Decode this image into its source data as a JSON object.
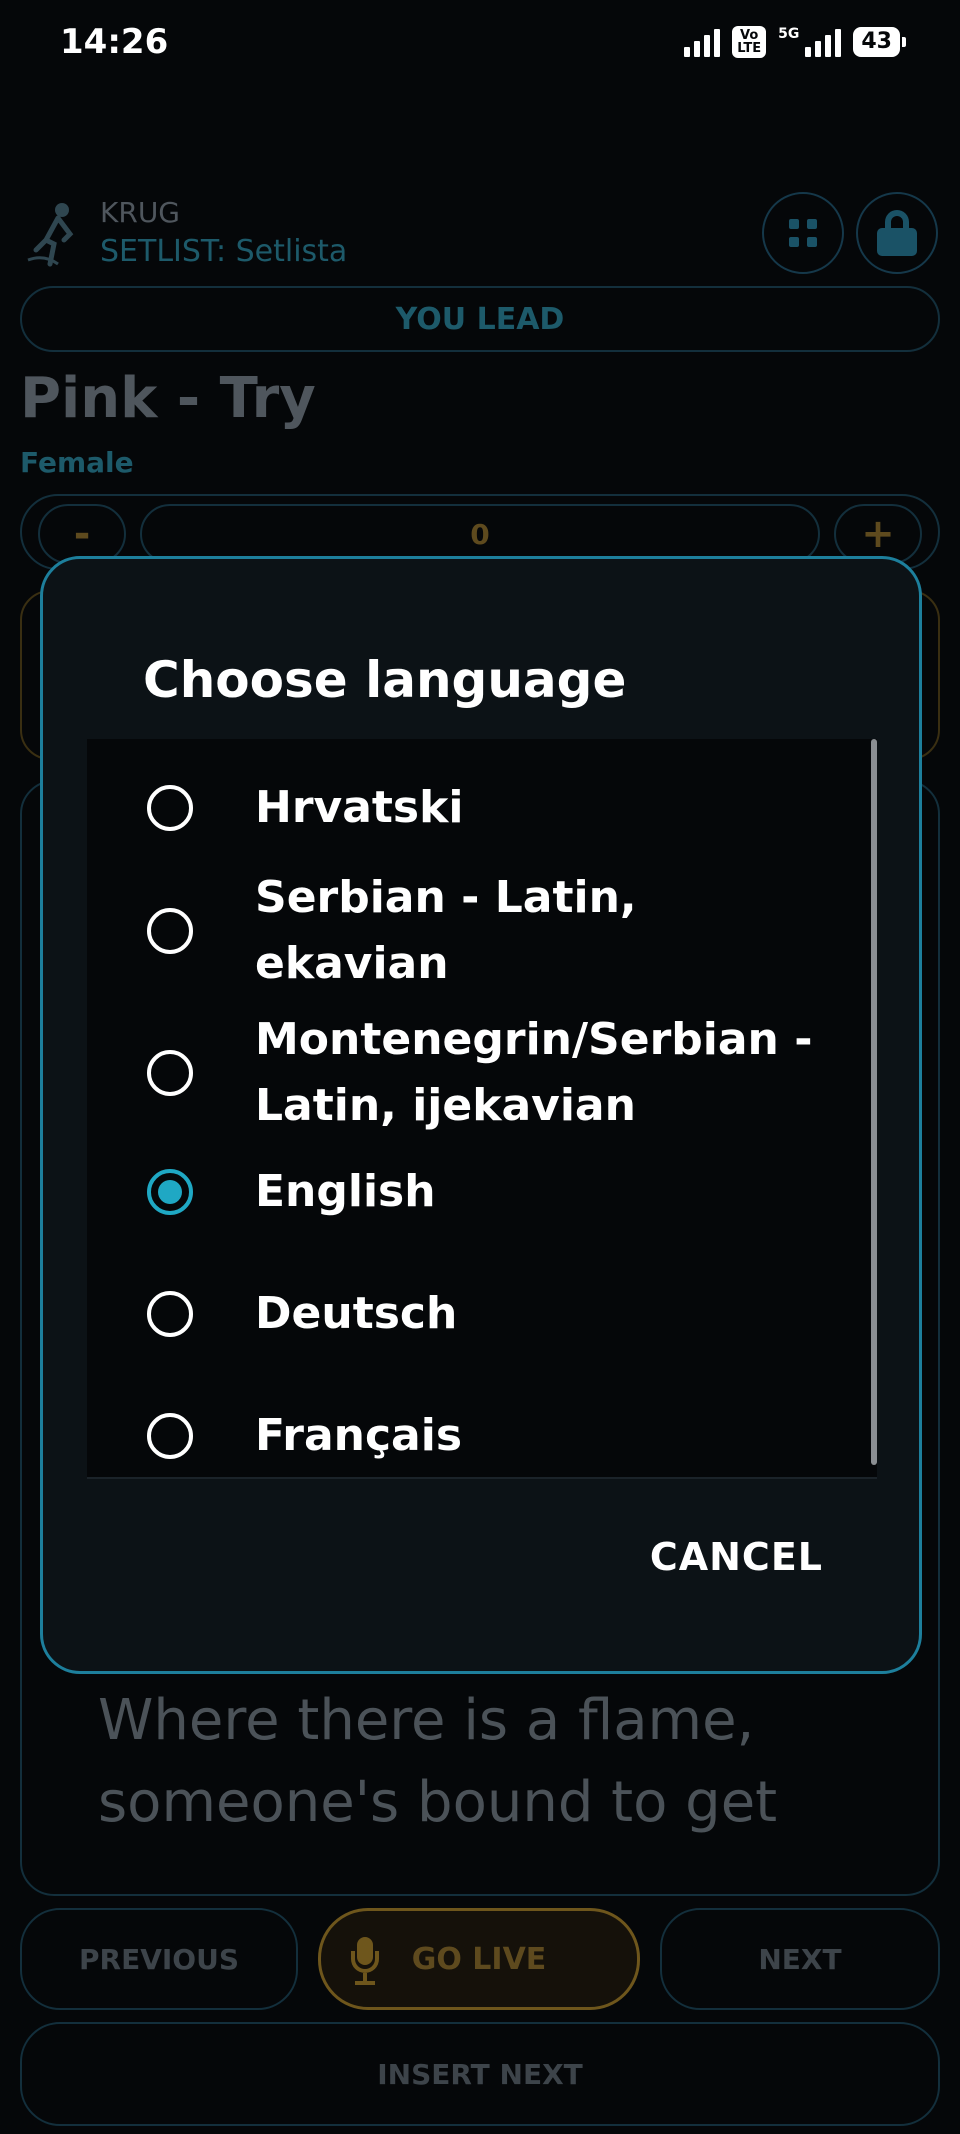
{
  "status_bar": {
    "time": "14:26",
    "volte_line1": "Vo",
    "volte_line2": "LTE",
    "network": "5G",
    "battery": "43"
  },
  "app": {
    "name": "KRUG",
    "setlist": "SETLIST: Setlista",
    "lead_label": "YOU LEAD",
    "song_title": "Pink - Try",
    "voice": "Female",
    "transpose_minus": "-",
    "transpose_value": "0",
    "transpose_plus": "+",
    "lyrics": "Where there is a flame, someone's bound to get",
    "previous_label": "PREVIOUS",
    "go_live_label": "GO LIVE",
    "next_label": "NEXT",
    "insert_next_label": "INSERT NEXT"
  },
  "dialog": {
    "title": "Choose language",
    "options": [
      {
        "label": "Hrvatski",
        "selected": false
      },
      {
        "label": "Serbian - Latin, ekavian",
        "selected": false
      },
      {
        "label": "Montenegrin/Serbian - Latin, ijekavian",
        "selected": false
      },
      {
        "label": "English",
        "selected": true
      },
      {
        "label": "Deutsch",
        "selected": false
      },
      {
        "label": "Français",
        "selected": false
      }
    ],
    "cancel_label": "CANCEL"
  },
  "colors": {
    "accent": "#1fa8c4",
    "dialog_border": "#1d7f9c",
    "gold": "#6e561c"
  }
}
